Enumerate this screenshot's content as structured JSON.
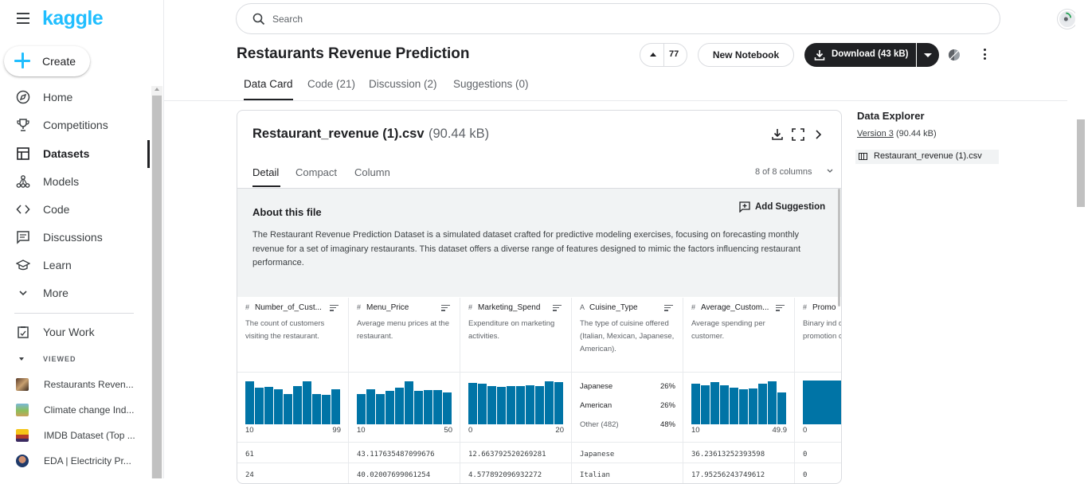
{
  "brand": {
    "logo": "kaggle"
  },
  "sidebar": {
    "create_label": "Create",
    "items": [
      {
        "label": "Home",
        "icon": "compass-icon"
      },
      {
        "label": "Competitions",
        "icon": "trophy-icon"
      },
      {
        "label": "Datasets",
        "icon": "table-icon"
      },
      {
        "label": "Models",
        "icon": "models-icon"
      },
      {
        "label": "Code",
        "icon": "code-icon"
      },
      {
        "label": "Discussions",
        "icon": "discussion-icon"
      },
      {
        "label": "Learn",
        "icon": "school-icon"
      },
      {
        "label": "More",
        "icon": "chevron-down-icon"
      }
    ],
    "your_work": "Your Work",
    "viewed_label": "VIEWED",
    "viewed": [
      {
        "label": "Restaurants Reven..."
      },
      {
        "label": "Climate change Ind..."
      },
      {
        "label": "IMDB Dataset (Top ..."
      },
      {
        "label": "EDA | Electricity Pr..."
      }
    ]
  },
  "search": {
    "placeholder": "Search"
  },
  "header": {
    "title": "Restaurants Revenue Prediction",
    "vote_count": "77",
    "new_notebook": "New Notebook",
    "download": "Download (43 kB)",
    "tabs": [
      "Data Card",
      "Code (21)",
      "Discussion (2)",
      "Suggestions (0)"
    ]
  },
  "file": {
    "name": "Restaurant_revenue (1).csv",
    "size": "(90.44 kB)",
    "subtabs": [
      "Detail",
      "Compact",
      "Column"
    ],
    "columns_count": "8 of 8 columns",
    "about_title": "About this file",
    "add_suggestion": "Add Suggestion",
    "about_text": "The Restaurant Revenue Prediction Dataset is a simulated dataset crafted for predictive modeling exercises, focusing on forecasting monthly revenue for a set of imaginary restaurants. This dataset offers a diverse range of features designed to mimic the factors influencing restaurant performance."
  },
  "columns": [
    {
      "type": "#",
      "name": "Number_of_Cust...",
      "desc": "The count of customers visiting the restaurant.",
      "min": "10",
      "max": "99",
      "hist": [
        0.98,
        0.83,
        0.85,
        0.8,
        0.7,
        0.88,
        0.98,
        0.7,
        0.67,
        0.8
      ],
      "r1": "61",
      "r2": "24"
    },
    {
      "type": "#",
      "name": "Menu_Price",
      "desc": "Average menu prices at the restaurant.",
      "min": "10",
      "max": "50",
      "hist": [
        0.7,
        0.8,
        0.7,
        0.77,
        0.83,
        0.98,
        0.77,
        0.78,
        0.78,
        0.73
      ],
      "r1": "43.117635487099676",
      "r2": "40.02007699061254"
    },
    {
      "type": "#",
      "name": "Marketing_Spend",
      "desc": "Expenditure on marketing activities.",
      "min": "0",
      "max": "20",
      "hist": [
        0.95,
        0.93,
        0.88,
        0.85,
        0.87,
        0.88,
        0.9,
        0.87,
        0.98,
        0.97
      ],
      "r1": "12.663792520269281",
      "r2": "4.577892096932272"
    },
    {
      "type": "A",
      "name": "Cuisine_Type",
      "desc": "The type of cuisine offered (Italian, Mexican, Japanese, American).",
      "categories": [
        {
          "label": "Japanese",
          "pct": "26%"
        },
        {
          "label": "American",
          "pct": "26%"
        },
        {
          "label": "Other (482)",
          "pct": "48%"
        }
      ],
      "r1": "Japanese",
      "r2": "Italian"
    },
    {
      "type": "#",
      "name": "Average_Custom...",
      "desc": "Average spending per customer.",
      "min": "10",
      "max": "49.9",
      "hist": [
        0.93,
        0.9,
        0.97,
        0.9,
        0.83,
        0.8,
        0.82,
        0.93,
        0.98,
        0.73
      ],
      "r1": "36.23613252393598",
      "r2": "17.95256243749612"
    },
    {
      "type": "#",
      "name": "Promo",
      "desc": "Binary ind denoting promotion conducte",
      "min": "0",
      "max": "",
      "hist": [
        1.0
      ],
      "r1": "0",
      "r2": "0"
    }
  ],
  "explorer": {
    "title": "Data Explorer",
    "version": "Version 3",
    "version_size": "(90.44 kB)",
    "file": "Restaurant_revenue (1).csv"
  }
}
